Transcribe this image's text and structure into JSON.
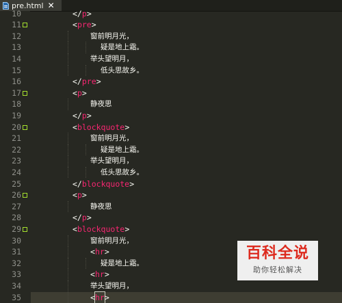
{
  "tab": {
    "title": "pre.html",
    "close_label": "✕"
  },
  "colors": {
    "background": "#272822",
    "tag": "#f92672",
    "text": "#f8f8f2",
    "gutter_text": "#8f908a",
    "fold_marker": "#a6e22e"
  },
  "lines": [
    {
      "n": "10",
      "fold": false,
      "active": false,
      "text": "</p>"
    },
    {
      "n": "11",
      "fold": true,
      "active": false,
      "text": "<pre>"
    },
    {
      "n": "12",
      "fold": false,
      "active": false,
      "text": "窗前明月光，"
    },
    {
      "n": "13",
      "fold": false,
      "active": false,
      "text": "疑是地上霜。"
    },
    {
      "n": "14",
      "fold": false,
      "active": false,
      "text": "举头望明月，"
    },
    {
      "n": "15",
      "fold": false,
      "active": false,
      "text": "低头思故乡。"
    },
    {
      "n": "16",
      "fold": false,
      "active": false,
      "text": "</pre>"
    },
    {
      "n": "17",
      "fold": true,
      "active": false,
      "text": "<p>"
    },
    {
      "n": "18",
      "fold": false,
      "active": false,
      "text": "静夜思"
    },
    {
      "n": "19",
      "fold": false,
      "active": false,
      "text": "</p>"
    },
    {
      "n": "20",
      "fold": true,
      "active": false,
      "text": "<blockquote>"
    },
    {
      "n": "21",
      "fold": false,
      "active": false,
      "text": "窗前明月光，"
    },
    {
      "n": "22",
      "fold": false,
      "active": false,
      "text": "疑是地上霜。"
    },
    {
      "n": "23",
      "fold": false,
      "active": false,
      "text": "举头望明月，"
    },
    {
      "n": "24",
      "fold": false,
      "active": false,
      "text": "低头思故乡。"
    },
    {
      "n": "25",
      "fold": false,
      "active": false,
      "text": "</blockquote>"
    },
    {
      "n": "26",
      "fold": true,
      "active": false,
      "text": "<p>"
    },
    {
      "n": "27",
      "fold": false,
      "active": false,
      "text": "静夜思"
    },
    {
      "n": "28",
      "fold": false,
      "active": false,
      "text": "</p>"
    },
    {
      "n": "29",
      "fold": true,
      "active": false,
      "text": "<blockquote>"
    },
    {
      "n": "30",
      "fold": false,
      "active": false,
      "text": "窗前明月光，"
    },
    {
      "n": "31",
      "fold": false,
      "active": false,
      "text": "<hr>"
    },
    {
      "n": "32",
      "fold": false,
      "active": false,
      "text": "疑是地上霜。"
    },
    {
      "n": "33",
      "fold": false,
      "active": false,
      "text": "<hr>"
    },
    {
      "n": "34",
      "fold": false,
      "active": false,
      "text": "举头望明月，"
    },
    {
      "n": "35",
      "fold": false,
      "active": true,
      "text": "<hr>"
    }
  ],
  "watermark": {
    "main": "百科全说",
    "sub": "助你轻松解决"
  }
}
